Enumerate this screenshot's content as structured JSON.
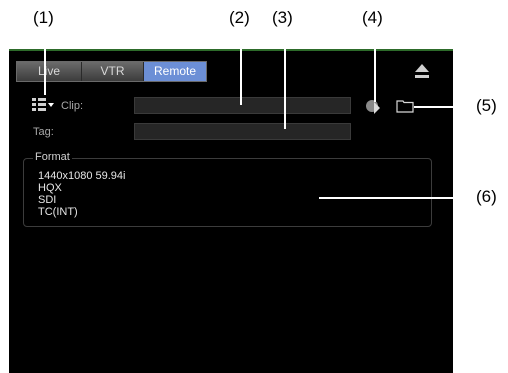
{
  "callouts": {
    "c1": "(1)",
    "c2": "(2)",
    "c3": "(3)",
    "c4": "(4)",
    "c5": "(5)",
    "c6": "(6)"
  },
  "tabs": {
    "live": "Live",
    "vtr": "VTR",
    "remote": "Remote",
    "active": "Remote"
  },
  "clip": {
    "label": "Clip:",
    "value": ""
  },
  "tag": {
    "label": "Tag:",
    "value": ""
  },
  "format": {
    "title": "Format",
    "resolution": "1440x1080 59.94i",
    "codec": "HQX",
    "input": "SDI",
    "timecode": "TC(INT)"
  },
  "icons": {
    "list_icon": "clip-list-dropdown-icon",
    "clip_icon": "clip-thumbnail-icon",
    "folder_icon": "folder-icon",
    "eject_icon": "eject-icon"
  },
  "colors": {
    "accent_tab": "#6c8fd6",
    "panel_bg": "#000000",
    "top_accent": "#2d6b2a"
  }
}
